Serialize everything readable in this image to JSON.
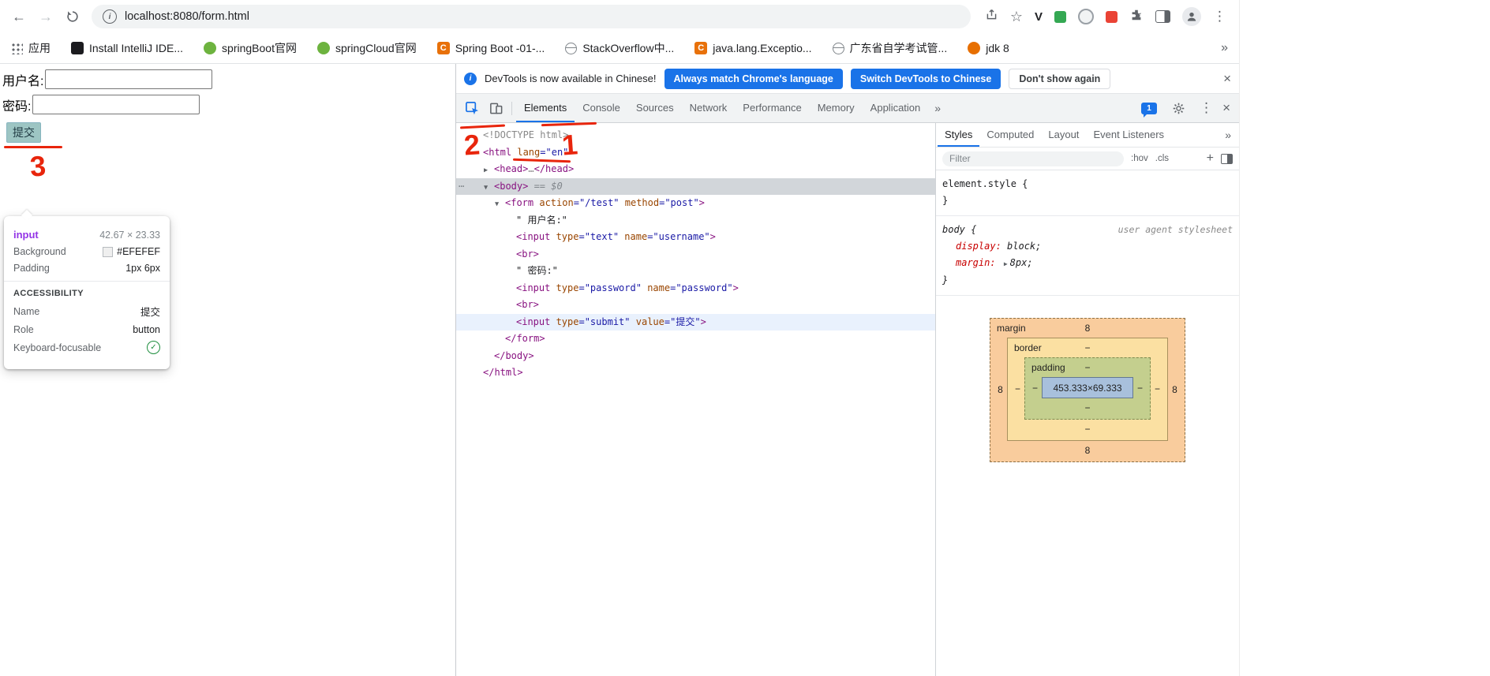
{
  "browser": {
    "url": "localhost:8080/form.html",
    "bookmarks": [
      {
        "label": "应用",
        "icon": "apps-grid-icon"
      },
      {
        "label": "Install IntelliJ IDE...",
        "icon": "intellij-icon"
      },
      {
        "label": "springBoot官网",
        "icon": "spring-icon"
      },
      {
        "label": "springCloud官网",
        "icon": "spring-icon"
      },
      {
        "label": "Spring Boot -01-...",
        "icon": "c-doc-icon"
      },
      {
        "label": "StackOverflow中...",
        "icon": "globe-icon"
      },
      {
        "label": "java.lang.Exceptio...",
        "icon": "c-doc-icon"
      },
      {
        "label": "广东省自学考试管...",
        "icon": "globe-icon"
      },
      {
        "label": "jdk 8",
        "icon": "java-icon"
      }
    ],
    "bookmarks_overflow": "»"
  },
  "page": {
    "username_label": "用户名:",
    "password_label": "密码:",
    "submit_button": "提交"
  },
  "tooltip": {
    "tag": "input",
    "size": "42.67 × 23.33",
    "background_label": "Background",
    "background_hex": "#EFEFEF",
    "padding_label": "Padding",
    "padding_value": "1px 6px",
    "accessibility_title": "ACCESSIBILITY",
    "name_label": "Name",
    "name_value": "提交",
    "role_label": "Role",
    "role_value": "button",
    "focusable_label": "Keyboard-focusable"
  },
  "devtools": {
    "notification": {
      "text": "DevTools is now available in Chinese!",
      "match_button": "Always match Chrome's language",
      "switch_button": "Switch DevTools to Chinese",
      "dismiss_button": "Don't show again"
    },
    "tabs": [
      {
        "label": "Elements",
        "selected": true
      },
      {
        "label": "Console"
      },
      {
        "label": "Sources"
      },
      {
        "label": "Network"
      },
      {
        "label": "Performance"
      },
      {
        "label": "Memory"
      },
      {
        "label": "Application"
      }
    ],
    "tabs_more": "»",
    "messages_badge": "1",
    "tree": [
      {
        "ind": 0,
        "tk": [
          [
            "g",
            "<!DOCTYPE html>"
          ]
        ]
      },
      {
        "ind": 0,
        "tk": [
          [
            "t",
            "<html "
          ],
          [
            "a",
            "lang"
          ],
          [
            "v",
            "=\"en\""
          ],
          [
            "t",
            ">"
          ]
        ]
      },
      {
        "ind": 1,
        "arrow": "r",
        "tk": [
          [
            "t",
            "<head>"
          ],
          [
            "g",
            "…"
          ],
          [
            "t",
            "</head>"
          ]
        ]
      },
      {
        "ind": 1,
        "arrow": "d",
        "gut": true,
        "hl": "sel",
        "tk": [
          [
            "t",
            "<body>"
          ],
          [
            "i",
            " == $0"
          ]
        ]
      },
      {
        "ind": 2,
        "arrow": "d",
        "tk": [
          [
            "t",
            "<form "
          ],
          [
            "a",
            "action"
          ],
          [
            "v",
            "=\"/test\""
          ],
          [
            "a",
            " method"
          ],
          [
            "v",
            "=\"post\""
          ],
          [
            "t",
            ">"
          ]
        ]
      },
      {
        "ind": 3,
        "tk": [
          [
            "x",
            "\" 用户名:\""
          ]
        ]
      },
      {
        "ind": 3,
        "tk": [
          [
            "t",
            "<input "
          ],
          [
            "a",
            "type"
          ],
          [
            "v",
            "=\"text\""
          ],
          [
            "a",
            " name"
          ],
          [
            "v",
            "=\"username\""
          ],
          [
            "t",
            ">"
          ]
        ]
      },
      {
        "ind": 3,
        "tk": [
          [
            "t",
            "<br>"
          ]
        ]
      },
      {
        "ind": 3,
        "tk": [
          [
            "x",
            "\" 密码:\""
          ]
        ]
      },
      {
        "ind": 3,
        "tk": [
          [
            "t",
            "<input "
          ],
          [
            "a",
            "type"
          ],
          [
            "v",
            "=\"password\""
          ],
          [
            "a",
            " name"
          ],
          [
            "v",
            "=\"password\""
          ],
          [
            "t",
            ">"
          ]
        ]
      },
      {
        "ind": 3,
        "tk": [
          [
            "t",
            "<br>"
          ]
        ]
      },
      {
        "ind": 3,
        "hl": "hov",
        "tk": [
          [
            "t",
            "<input "
          ],
          [
            "a",
            "type"
          ],
          [
            "v",
            "=\"submit\""
          ],
          [
            "a",
            " value"
          ],
          [
            "v",
            "=\"提交\""
          ],
          [
            "t",
            ">"
          ]
        ]
      },
      {
        "ind": 2,
        "tk": [
          [
            "t",
            "</form>"
          ]
        ]
      },
      {
        "ind": 1,
        "tk": [
          [
            "t",
            "</body>"
          ]
        ]
      },
      {
        "ind": 0,
        "tk": [
          [
            "t",
            "</html>"
          ]
        ]
      }
    ],
    "styles_pane": {
      "tabs": [
        {
          "label": "Styles",
          "selected": true
        },
        {
          "label": "Computed"
        },
        {
          "label": "Layout"
        },
        {
          "label": "Event Listeners"
        }
      ],
      "more": "»",
      "filter_placeholder": "Filter",
      "hov": ":hov",
      "cls": ".cls",
      "plus": "+",
      "element_style_open": "element.style {",
      "element_style_close": "}",
      "body_open": "body {",
      "body_close": "}",
      "ua_note": "user agent stylesheet",
      "prop1_name": "display:",
      "prop1_value": "block;",
      "prop2_name": "margin:",
      "prop2_value": "8px;"
    },
    "box_model": {
      "margin_label": "margin",
      "border_label": "border",
      "padding_label": "padding",
      "content": "453.333×69.333",
      "eight": "8",
      "dash": "−"
    }
  },
  "annotations": {
    "mark1": "1",
    "mark2": "2",
    "mark3": "3"
  }
}
